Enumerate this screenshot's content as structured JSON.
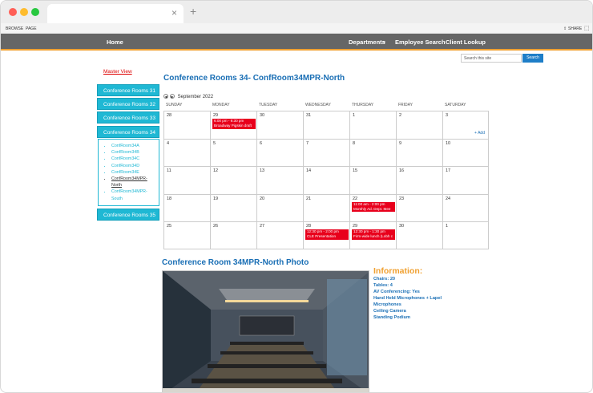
{
  "browser": {
    "tab_close": "×",
    "tab_new": "+"
  },
  "ribbon": {
    "browse": "BROWSE",
    "page": "PAGE",
    "share": "SHARE"
  },
  "nav": {
    "home": "Home",
    "departments": "Departments",
    "employee_search": "Employee Search",
    "client_lookup": "Client Lookup"
  },
  "search": {
    "placeholder": "Search this site",
    "button": "Search"
  },
  "sidebar": {
    "master_view": "Master View",
    "items": [
      "Conference Rooms 31",
      "Conference Rooms 32",
      "Conference Rooms 33",
      "Conference Rooms 34",
      "Conference Rooms 35"
    ],
    "sub_items": [
      "ConfRoom34A",
      "ConfRoom34B",
      "ConfRoom34C",
      "ConfRoom34D",
      "ConfRoom34E",
      "ConfRoom34MPR-North",
      "ConfRoom34MPR-South"
    ]
  },
  "page_title": "Conference Rooms 34- ConfRoom34MPR-North",
  "calendar": {
    "month": "September 2022",
    "days": [
      "SUNDAY",
      "MONDAY",
      "TUESDAY",
      "WEDNESDAY",
      "THURSDAY",
      "FRIDAY",
      "SATURDAY"
    ],
    "weeks": [
      [
        "28",
        "29",
        "30",
        "31",
        "1",
        "2",
        "3"
      ],
      [
        "4",
        "5",
        "6",
        "7",
        "8",
        "9",
        "10"
      ],
      [
        "11",
        "12",
        "13",
        "14",
        "15",
        "16",
        "17"
      ],
      [
        "18",
        "19",
        "20",
        "21",
        "22",
        "23",
        "24"
      ],
      [
        "25",
        "26",
        "27",
        "28",
        "29",
        "30",
        "1"
      ]
    ],
    "events": [
      {
        "week": 0,
        "day": 1,
        "time": "6:00 pm - 9:30 pm",
        "title": "Broadway Pigskin draft"
      },
      {
        "week": 3,
        "day": 4,
        "time": "11:00 am - 2:00 pm",
        "title": "Monthly Ad. Dept. Mee"
      },
      {
        "week": 4,
        "day": 3,
        "time": "12:30 pm - 2:00 pm",
        "title": "CLE Presentation"
      },
      {
        "week": 4,
        "day": 4,
        "time": "12:30 pm - 1:30 pm",
        "title": "Firm-wide lunch (Lobh c"
      }
    ],
    "add_label": "Add",
    "event_color": "#e8001c"
  },
  "photo_title": "Conference Room 34MPR-North Photo",
  "info": {
    "title": "Information:",
    "lines": [
      "Chairs: 20",
      "Tables: 4",
      "AV Conferencing: Yes",
      "Hand Held Microphones + Lapel",
      "Microphones",
      "Ceiling Camera",
      "Standing Podium"
    ]
  },
  "colors": {
    "accent": "#1fb8d4",
    "title_blue": "#1a6fb5",
    "nav_bg": "#666666",
    "info_orange": "#f0a030"
  }
}
